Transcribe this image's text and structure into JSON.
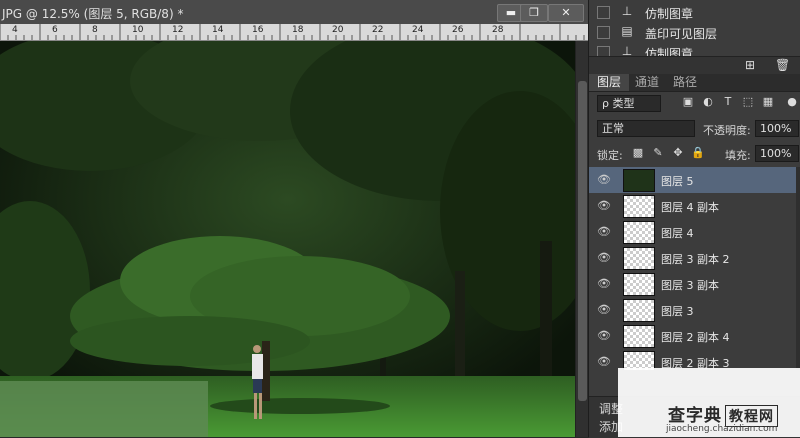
{
  "document": {
    "title": "JPG @ 12.5% (图层 5, RGB/8) *",
    "controls": {
      "minimize": "▬",
      "restore": "❐",
      "close": "✕"
    },
    "ruler_labels": [
      "4",
      "6",
      "8",
      "10",
      "12",
      "14",
      "16",
      "18",
      "20",
      "22",
      "24",
      "26",
      "28"
    ]
  },
  "history": {
    "items": [
      {
        "label": "仿制图章",
        "icon": "stamp-icon"
      },
      {
        "label": "盖印可见图层",
        "icon": "document-icon"
      },
      {
        "label": "仿制图章",
        "icon": "stamp-icon"
      }
    ]
  },
  "panel_tabs": [
    "图层",
    "通道",
    "路径"
  ],
  "layers_panel": {
    "filter_label": "ρ 类型",
    "blend_mode": "正常",
    "opacity_label": "不透明度:",
    "opacity_value": "100%",
    "lock_label": "锁定:",
    "fill_label": "填充:",
    "fill_value": "100%",
    "layers": [
      {
        "name": "图层 5",
        "selected": true,
        "thumb": "image"
      },
      {
        "name": "图层 4 副本",
        "selected": false,
        "thumb": "transparent"
      },
      {
        "name": "图层 4",
        "selected": false,
        "thumb": "transparent"
      },
      {
        "name": "图层 3 副本 2",
        "selected": false,
        "thumb": "transparent"
      },
      {
        "name": "图层 3 副本",
        "selected": false,
        "thumb": "transparent"
      },
      {
        "name": "图层 3",
        "selected": false,
        "thumb": "transparent"
      },
      {
        "name": "图层 2 副本 4",
        "selected": false,
        "thumb": "transparent"
      },
      {
        "name": "图层 2 副本 3",
        "selected": false,
        "thumb": "transparent"
      }
    ]
  },
  "bottom_panel": {
    "label1": "调整",
    "label2": "添加"
  },
  "watermark": {
    "brand": "查字典",
    "box_text": "教程网",
    "url": "jiaocheng.chazidian.com"
  },
  "colors": {
    "selected_layer": "#56667c",
    "panel_bg": "#3c3c3c",
    "grass": "#3f8a2c"
  }
}
